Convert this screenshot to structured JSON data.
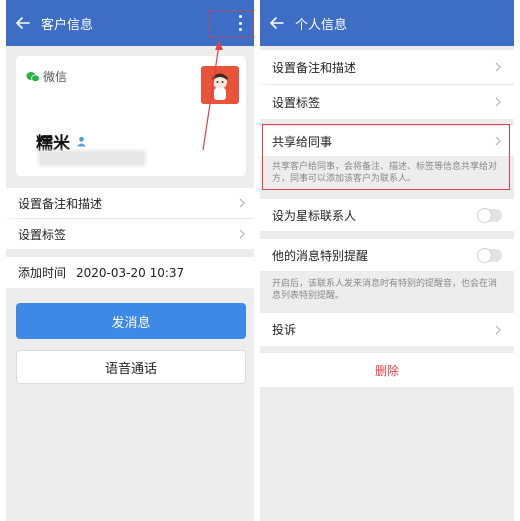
{
  "left": {
    "header": {
      "title": "客户信息"
    },
    "card": {
      "wechat_label": "微信",
      "name": "糯米"
    },
    "rows": [
      {
        "label": "设置备注和描述"
      },
      {
        "label": "设置标签"
      }
    ],
    "added": {
      "label": "添加时间",
      "value": "2020-03-20 10:37"
    },
    "send_button": "发消息",
    "voice_button": "语音通话"
  },
  "right": {
    "header": {
      "title": "个人信息"
    },
    "items": {
      "remark": "设置备注和描述",
      "tags": "设置标签",
      "share": "共享给同事",
      "share_desc": "共享客户给同事，会将备注、描述、标签等信息共享给对方，同事可以添加该客户为联系人。",
      "star": "设为星标联系人",
      "special_remind": "他的消息特别提醒",
      "special_desc": "开启后，该联系人发来消息时有特别的提醒音，也会在消息列表特别提醒。",
      "report": "投诉",
      "delete": "删除"
    }
  },
  "colors": {
    "header": "#3d6dc4",
    "primary_button": "#3d8ae6",
    "danger": "#e0404a",
    "annotation": "#e0404a",
    "wechat_green": "#2bb34a"
  }
}
